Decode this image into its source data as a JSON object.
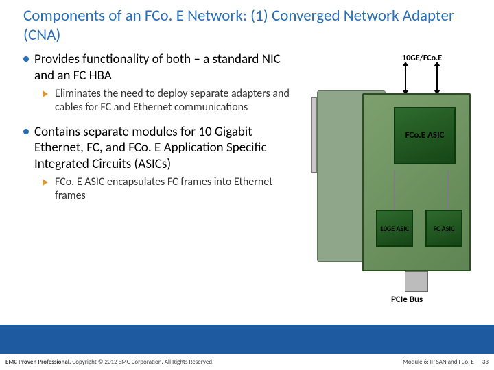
{
  "title": "Components of an FCo. E Network: (1) Converged Network Adapter (CNA)",
  "bullets": {
    "b1": "Provides functionality of both – a standard NIC and an FC HBA",
    "b1s": "Eliminates the need to deploy separate adapters and cables for FC and Ethernet communications",
    "b2": "Contains separate modules for 10 Gigabit Ethernet, FC, and FCo. E Application Specific Integrated Circuits (ASICs)",
    "b2s": "FCo. E ASIC encapsulates FC frames into Ethernet frames"
  },
  "diagram": {
    "top_label": "10GE/FCo.E",
    "chip_main": "FCo.E ASIC",
    "chip_left": "10GE ASIC",
    "chip_right": "FC ASIC",
    "bus_label": "PCIe Bus"
  },
  "footer": {
    "left_bold": "EMC Proven Professional.",
    "left_rest": " Copyright © 2012 EMC Corporation. All Rights Reserved.",
    "module": "Module 6: IP SAN and FCo. E",
    "page": "33"
  }
}
